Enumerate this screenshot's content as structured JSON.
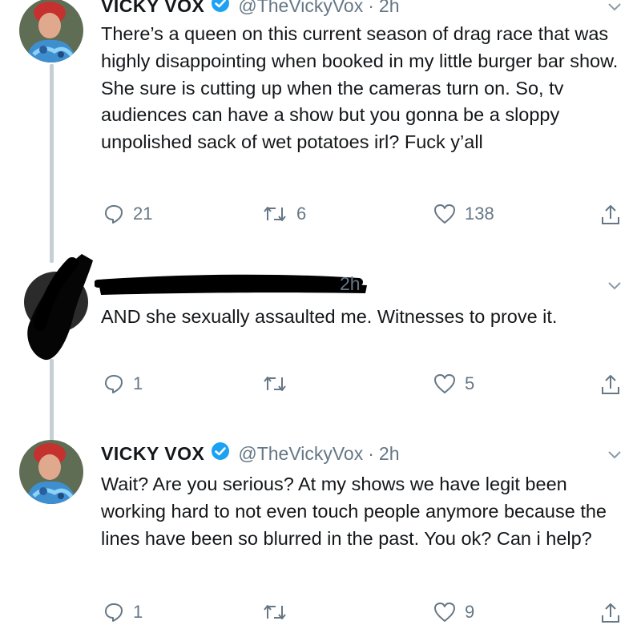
{
  "tweets": [
    {
      "display_name": "VICKY VOX",
      "handle": "@TheVickyVox",
      "separator": "·",
      "time": "2h",
      "text": "There’s a queen on this current season of drag race that was highly disappointing when booked in my little burger bar show. She sure is cutting up when the cameras turn on. So, tv audiences can have a show but you gonna be a sloppy unpolished sack of wet potatoes irl? Fuck y’all",
      "replies": "21",
      "retweets": "6",
      "likes": "138"
    },
    {
      "time": "2h",
      "text": "AND she sexually assaulted me. Witnesses to prove it.",
      "replies": "1",
      "retweets": "",
      "likes": "5"
    },
    {
      "display_name": "VICKY VOX",
      "handle": "@TheVickyVox",
      "separator": "·",
      "time": "2h",
      "text": "Wait? Are you serious? At my shows we have legit been working hard to not even touch people anymore because the lines have been so blurred in the past. You ok? Can i help?",
      "replies": "1",
      "retweets": "",
      "likes": "9"
    }
  ],
  "icons": {
    "reply": "reply-icon",
    "retweet": "retweet-icon",
    "like": "heart-icon",
    "share": "share-icon",
    "caret": "chevron-down-icon",
    "verified": "verified-badge-icon"
  },
  "colors": {
    "text": "#14171a",
    "muted": "#657786",
    "verified_blue": "#1da1f2",
    "thread_line": "#c4cfd6"
  }
}
